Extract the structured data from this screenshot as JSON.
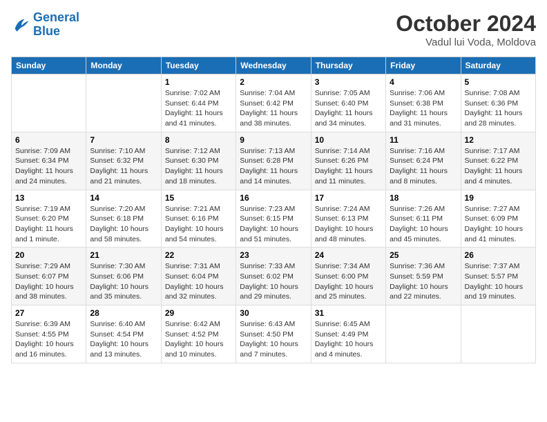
{
  "header": {
    "logo_text_general": "General",
    "logo_text_blue": "Blue",
    "month_title": "October 2024",
    "subtitle": "Vadul lui Voda, Moldova"
  },
  "weekdays": [
    "Sunday",
    "Monday",
    "Tuesday",
    "Wednesday",
    "Thursday",
    "Friday",
    "Saturday"
  ],
  "weeks": [
    [
      {
        "day": "",
        "info": ""
      },
      {
        "day": "",
        "info": ""
      },
      {
        "day": "1",
        "info": "Sunrise: 7:02 AM\nSunset: 6:44 PM\nDaylight: 11 hours and 41 minutes."
      },
      {
        "day": "2",
        "info": "Sunrise: 7:04 AM\nSunset: 6:42 PM\nDaylight: 11 hours and 38 minutes."
      },
      {
        "day": "3",
        "info": "Sunrise: 7:05 AM\nSunset: 6:40 PM\nDaylight: 11 hours and 34 minutes."
      },
      {
        "day": "4",
        "info": "Sunrise: 7:06 AM\nSunset: 6:38 PM\nDaylight: 11 hours and 31 minutes."
      },
      {
        "day": "5",
        "info": "Sunrise: 7:08 AM\nSunset: 6:36 PM\nDaylight: 11 hours and 28 minutes."
      }
    ],
    [
      {
        "day": "6",
        "info": "Sunrise: 7:09 AM\nSunset: 6:34 PM\nDaylight: 11 hours and 24 minutes."
      },
      {
        "day": "7",
        "info": "Sunrise: 7:10 AM\nSunset: 6:32 PM\nDaylight: 11 hours and 21 minutes."
      },
      {
        "day": "8",
        "info": "Sunrise: 7:12 AM\nSunset: 6:30 PM\nDaylight: 11 hours and 18 minutes."
      },
      {
        "day": "9",
        "info": "Sunrise: 7:13 AM\nSunset: 6:28 PM\nDaylight: 11 hours and 14 minutes."
      },
      {
        "day": "10",
        "info": "Sunrise: 7:14 AM\nSunset: 6:26 PM\nDaylight: 11 hours and 11 minutes."
      },
      {
        "day": "11",
        "info": "Sunrise: 7:16 AM\nSunset: 6:24 PM\nDaylight: 11 hours and 8 minutes."
      },
      {
        "day": "12",
        "info": "Sunrise: 7:17 AM\nSunset: 6:22 PM\nDaylight: 11 hours and 4 minutes."
      }
    ],
    [
      {
        "day": "13",
        "info": "Sunrise: 7:19 AM\nSunset: 6:20 PM\nDaylight: 11 hours and 1 minute."
      },
      {
        "day": "14",
        "info": "Sunrise: 7:20 AM\nSunset: 6:18 PM\nDaylight: 10 hours and 58 minutes."
      },
      {
        "day": "15",
        "info": "Sunrise: 7:21 AM\nSunset: 6:16 PM\nDaylight: 10 hours and 54 minutes."
      },
      {
        "day": "16",
        "info": "Sunrise: 7:23 AM\nSunset: 6:15 PM\nDaylight: 10 hours and 51 minutes."
      },
      {
        "day": "17",
        "info": "Sunrise: 7:24 AM\nSunset: 6:13 PM\nDaylight: 10 hours and 48 minutes."
      },
      {
        "day": "18",
        "info": "Sunrise: 7:26 AM\nSunset: 6:11 PM\nDaylight: 10 hours and 45 minutes."
      },
      {
        "day": "19",
        "info": "Sunrise: 7:27 AM\nSunset: 6:09 PM\nDaylight: 10 hours and 41 minutes."
      }
    ],
    [
      {
        "day": "20",
        "info": "Sunrise: 7:29 AM\nSunset: 6:07 PM\nDaylight: 10 hours and 38 minutes."
      },
      {
        "day": "21",
        "info": "Sunrise: 7:30 AM\nSunset: 6:06 PM\nDaylight: 10 hours and 35 minutes."
      },
      {
        "day": "22",
        "info": "Sunrise: 7:31 AM\nSunset: 6:04 PM\nDaylight: 10 hours and 32 minutes."
      },
      {
        "day": "23",
        "info": "Sunrise: 7:33 AM\nSunset: 6:02 PM\nDaylight: 10 hours and 29 minutes."
      },
      {
        "day": "24",
        "info": "Sunrise: 7:34 AM\nSunset: 6:00 PM\nDaylight: 10 hours and 25 minutes."
      },
      {
        "day": "25",
        "info": "Sunrise: 7:36 AM\nSunset: 5:59 PM\nDaylight: 10 hours and 22 minutes."
      },
      {
        "day": "26",
        "info": "Sunrise: 7:37 AM\nSunset: 5:57 PM\nDaylight: 10 hours and 19 minutes."
      }
    ],
    [
      {
        "day": "27",
        "info": "Sunrise: 6:39 AM\nSunset: 4:55 PM\nDaylight: 10 hours and 16 minutes."
      },
      {
        "day": "28",
        "info": "Sunrise: 6:40 AM\nSunset: 4:54 PM\nDaylight: 10 hours and 13 minutes."
      },
      {
        "day": "29",
        "info": "Sunrise: 6:42 AM\nSunset: 4:52 PM\nDaylight: 10 hours and 10 minutes."
      },
      {
        "day": "30",
        "info": "Sunrise: 6:43 AM\nSunset: 4:50 PM\nDaylight: 10 hours and 7 minutes."
      },
      {
        "day": "31",
        "info": "Sunrise: 6:45 AM\nSunset: 4:49 PM\nDaylight: 10 hours and 4 minutes."
      },
      {
        "day": "",
        "info": ""
      },
      {
        "day": "",
        "info": ""
      }
    ]
  ]
}
